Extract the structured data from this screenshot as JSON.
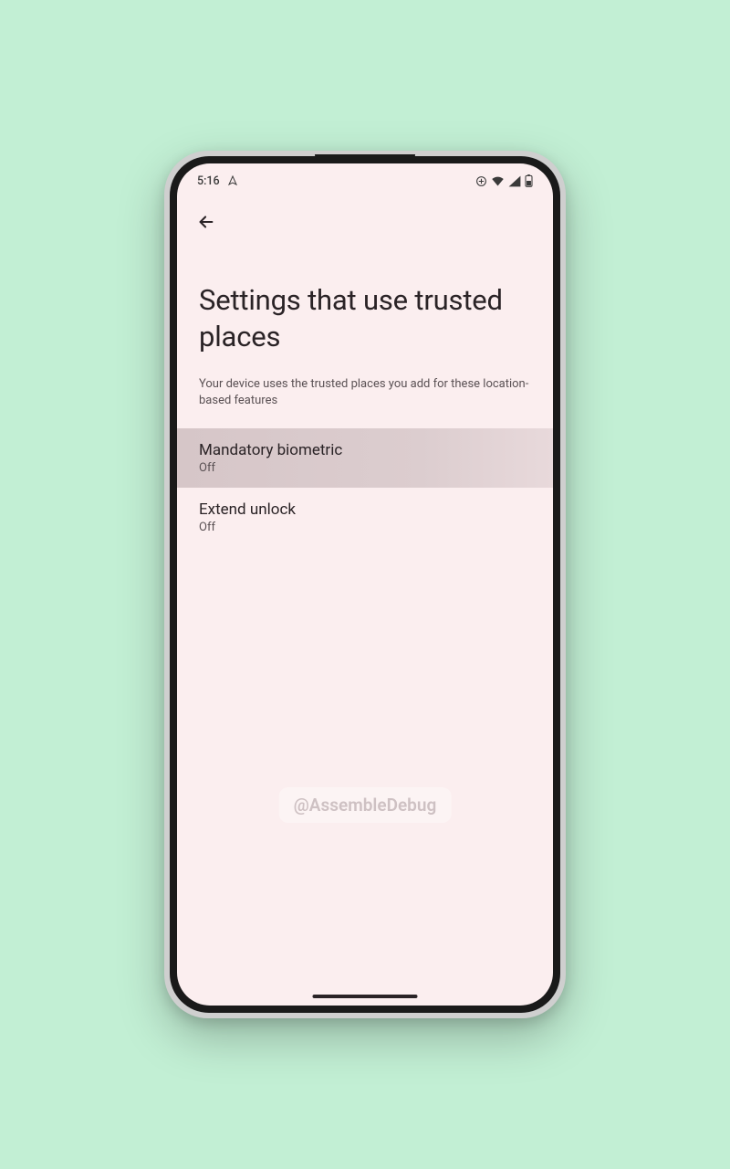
{
  "statusbar": {
    "time": "5:16"
  },
  "page": {
    "title": "Settings that use trusted places",
    "subtitle": "Your device uses the trusted places you add for these location-based features"
  },
  "items": [
    {
      "title": "Mandatory biometric",
      "subtitle": "Off",
      "highlighted": true
    },
    {
      "title": "Extend unlock",
      "subtitle": "Off",
      "highlighted": false
    }
  ],
  "watermark": "@AssembleDebug"
}
